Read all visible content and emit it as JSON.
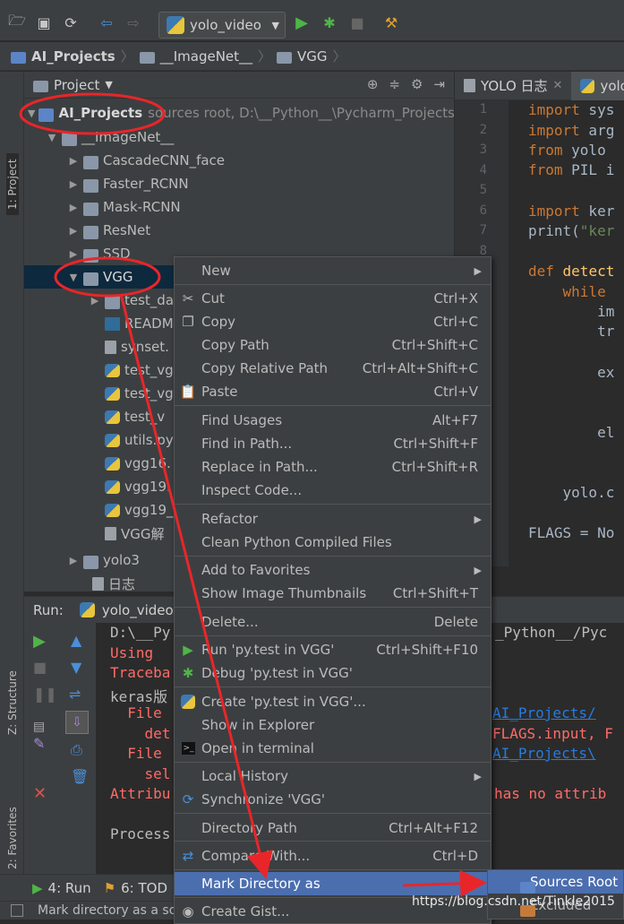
{
  "toolbar": {
    "run_config": "yolo_video",
    "icons": [
      "folder-open-icon",
      "save-icon",
      "sync-icon",
      "back-icon",
      "forward-icon",
      "run-icon",
      "debug-icon",
      "stop-icon",
      "settings-icon"
    ]
  },
  "breadcrumbs": [
    "AI_Projects",
    "__ImageNet__",
    "VGG"
  ],
  "side_tabs": {
    "project": "1: Project",
    "structure": "Z: Structure",
    "favorites": "2: Favorites"
  },
  "project_panel": {
    "title": "Project",
    "tree": [
      {
        "label": "AI_Projects",
        "hint": "sources root,  D:\\__Python__\\Pycharm_Projects\\"
      },
      {
        "label": "__ImageNet__"
      },
      {
        "label": "CascadeCNN_face"
      },
      {
        "label": "Faster_RCNN"
      },
      {
        "label": "Mask-RCNN"
      },
      {
        "label": "ResNet"
      },
      {
        "label": "SSD"
      },
      {
        "label": "VGG"
      },
      {
        "label": "test_da"
      },
      {
        "label": "READM"
      },
      {
        "label": "synset."
      },
      {
        "label": "test_vg"
      },
      {
        "label": "test_vg"
      },
      {
        "label": "test_v"
      },
      {
        "label": "utils.py"
      },
      {
        "label": "vgg16."
      },
      {
        "label": "vgg19."
      },
      {
        "label": "vgg19_"
      },
      {
        "label": "VGG解"
      },
      {
        "label": "yolo3"
      },
      {
        "label": "日志"
      }
    ]
  },
  "editor": {
    "tabs": [
      "YOLO 日志",
      "yolo"
    ],
    "line_numbers": [
      "1",
      "2",
      "3",
      "4",
      "5",
      "6",
      "7",
      "8"
    ],
    "code": {
      "l1_kw": "import",
      "l1": " sys",
      "l2_kw": "import",
      "l2": " arg",
      "l3_kw": "from",
      "l3": " yolo",
      "l4_kw": "from",
      "l4": " PIL i",
      "l6_kw": "import",
      "l6": " ker",
      "l7": "print(",
      "l7_str": "\"ker",
      "l9_kw": "def",
      "l9_fn": " detect",
      "l10_kw": "    while",
      "l11": "        im",
      "l12": "        tr",
      "l14": "        ex",
      "l16": "        el",
      "l18": "    yolo.c",
      "l20": "FLAGS = No"
    }
  },
  "run_panel": {
    "label": "Run:",
    "config": "yolo_video",
    "console": {
      "c1": "D:\\__Py",
      "c1b": "_Python__/Pyc",
      "c2": "Using ",
      "c3": "Traceba",
      "c4": "keras版",
      "c5": "  File",
      "c5b": "AI_Projects/",
      "c6": "    det",
      "c6b": "FLAGS.input, F",
      "c7": "  File",
      "c7b": "AI_Projects\\",
      "c8": "    sel",
      "c9": "Attribu",
      "c9b": "has no attrib",
      "c10": "Process"
    }
  },
  "bottom_tabs": [
    "4: Run",
    "6: TOD"
  ],
  "status": "Mark directory as a so",
  "context_menu": {
    "items": [
      {
        "label": "New",
        "shortcut": "",
        "submenu": true,
        "icon": ""
      },
      {
        "label": "Cut",
        "shortcut": "Ctrl+X",
        "icon": "scissors-icon"
      },
      {
        "label": "Copy",
        "shortcut": "Ctrl+C",
        "icon": "copy-icon"
      },
      {
        "label": "Copy Path",
        "shortcut": "Ctrl+Shift+C",
        "icon": ""
      },
      {
        "label": "Copy Relative Path",
        "shortcut": "Ctrl+Alt+Shift+C",
        "icon": ""
      },
      {
        "label": "Paste",
        "shortcut": "Ctrl+V",
        "icon": "paste-icon"
      },
      {
        "label": "Find Usages",
        "shortcut": "Alt+F7",
        "icon": ""
      },
      {
        "label": "Find in Path...",
        "shortcut": "Ctrl+Shift+F",
        "icon": ""
      },
      {
        "label": "Replace in Path...",
        "shortcut": "Ctrl+Shift+R",
        "icon": ""
      },
      {
        "label": "Inspect Code...",
        "shortcut": "",
        "icon": ""
      },
      {
        "label": "Refactor",
        "shortcut": "",
        "submenu": true,
        "icon": ""
      },
      {
        "label": "Clean Python Compiled Files",
        "shortcut": "",
        "icon": ""
      },
      {
        "label": "Add to Favorites",
        "shortcut": "",
        "submenu": true,
        "icon": ""
      },
      {
        "label": "Show Image Thumbnails",
        "shortcut": "Ctrl+Shift+T",
        "icon": ""
      },
      {
        "label": "Delete...",
        "shortcut": "Delete",
        "icon": ""
      },
      {
        "label": "Run 'py.test in VGG'",
        "shortcut": "Ctrl+Shift+F10",
        "icon": "run-icon"
      },
      {
        "label": "Debug 'py.test in VGG'",
        "shortcut": "",
        "icon": "debug-icon"
      },
      {
        "label": "Create 'py.test in VGG'...",
        "shortcut": "",
        "icon": "python-icon"
      },
      {
        "label": "Show in Explorer",
        "shortcut": "",
        "icon": ""
      },
      {
        "label": "Open in terminal",
        "shortcut": "",
        "icon": "terminal-icon"
      },
      {
        "label": "Local History",
        "shortcut": "",
        "submenu": true,
        "icon": ""
      },
      {
        "label": "Synchronize 'VGG'",
        "shortcut": "",
        "icon": "sync-icon"
      },
      {
        "label": "Directory Path",
        "shortcut": "Ctrl+Alt+F12",
        "icon": ""
      },
      {
        "label": "Compare With...",
        "shortcut": "Ctrl+D",
        "icon": "compare-icon"
      },
      {
        "label": "Mark Directory as",
        "shortcut": "",
        "submenu": true,
        "icon": ""
      },
      {
        "label": "Create Gist...",
        "shortcut": "",
        "icon": "github-icon"
      }
    ]
  },
  "submenu": {
    "items": [
      "Sources Root",
      "Excluded"
    ]
  },
  "watermark": "https://blog.csdn.net/Tinkle2015",
  "annotation_color": "#e8262a"
}
